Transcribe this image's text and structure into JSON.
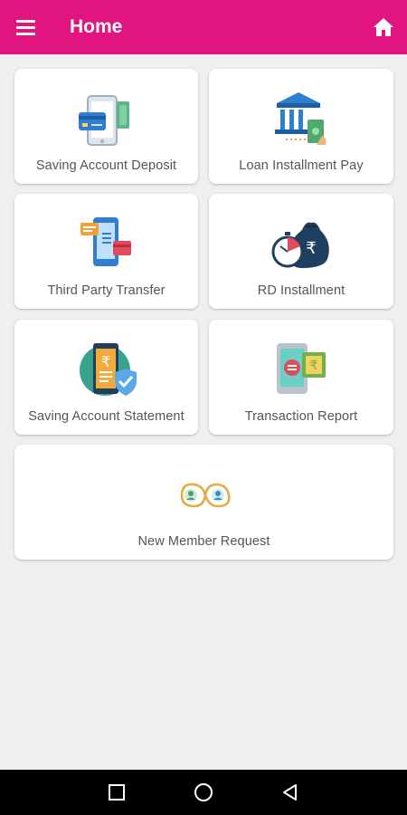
{
  "appbar": {
    "title": "Home",
    "menu_icon": "hamburger-menu-icon",
    "home_icon": "home-icon",
    "color": "#e0157f"
  },
  "tiles": [
    {
      "label": "Saving Account Deposit",
      "icon": "mobile-card-deposit-icon"
    },
    {
      "label": "Loan Installment Pay",
      "icon": "bank-cash-icon"
    },
    {
      "label": "Third Party Transfer",
      "icon": "phone-transfer-icon"
    },
    {
      "label": "RD Installment",
      "icon": "timer-money-bag-icon"
    },
    {
      "label": "Saving Account Statement",
      "icon": "secure-statement-icon"
    },
    {
      "label": "Transaction Report",
      "icon": "phone-rupee-exchange-icon"
    },
    {
      "label": "New Member Request",
      "icon": "member-link-icon"
    }
  ],
  "system_nav": {
    "recent": "recent-apps-icon",
    "home": "home-circle-icon",
    "back": "back-triangle-icon"
  }
}
